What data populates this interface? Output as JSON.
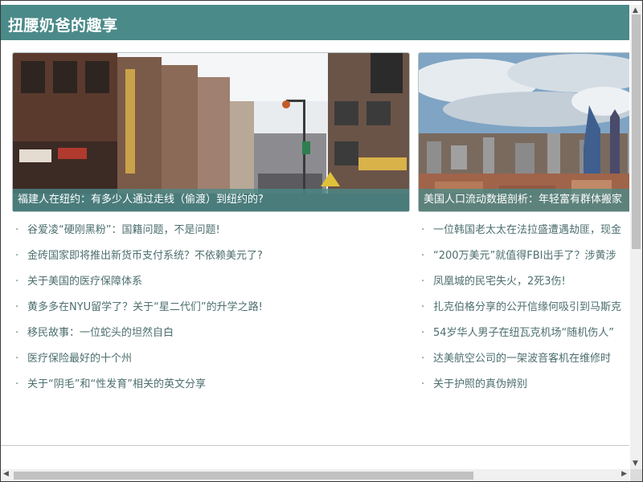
{
  "header": {
    "title": "扭腰奶爸的趣享"
  },
  "columns": [
    {
      "photo_caption": "福建人在纽约：有多少人通过走线（偷渡）到纽约的?",
      "photo_subject": "chinatown-street-photo",
      "items": [
        "谷爱凌“硬刚黑粉”：国籍问题，不是问题!",
        "金砖国家即将推出新货币支付系统？不依赖美元了?",
        "关于美国的医疗保障体系",
        "黄多多在NYU留学了？关于“星二代们”的升学之路!",
        "移民故事：一位蛇头的坦然自白",
        "医疗保险最好的十个州",
        "关于“阴毛”和“性发育”相关的英文分享"
      ]
    },
    {
      "photo_caption": "美国人口流动数据剖析：年轻富有群体搬家",
      "photo_subject": "city-skyline-photo",
      "items": [
        "一位韩国老太太在法拉盛遭遇劫匪，现金",
        "“200万美元”就值得FBI出手了？涉黄涉",
        "凤凰城的民宅失火，2死3伤!",
        "扎克伯格分享的公开信缘何吸引到马斯克",
        "54岁华人男子在纽瓦克机场“随机伤人”",
        "达美航空公司的一架波音客机在维修时",
        "关于护照的真伪辨别"
      ]
    }
  ],
  "colors": {
    "header_bg": "#4a8a89",
    "caption_bg": "#4a8a89",
    "link_text": "#4d6e6e"
  }
}
